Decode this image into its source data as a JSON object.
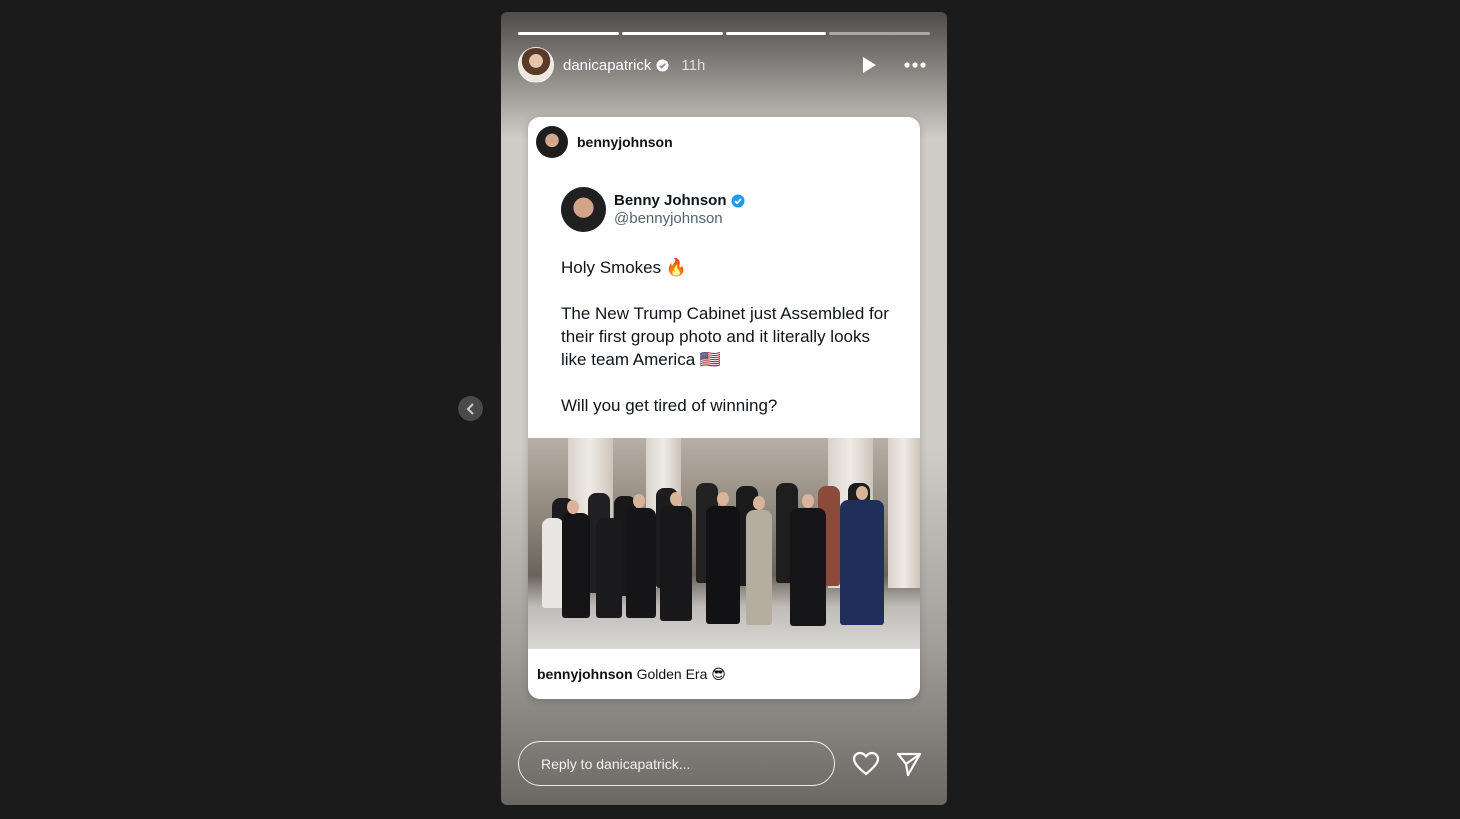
{
  "story": {
    "username": "danicapatrick",
    "time": "11h",
    "segments": 4,
    "active_segment": 3
  },
  "card": {
    "username": "bennyjohnson",
    "tweet": {
      "name": "Benny Johnson",
      "handle": "@bennyjohnson",
      "line1": "Holy Smokes 🔥",
      "line2": "The New Trump Cabinet just Assembled for their first group photo and it literally looks like team America 🇺🇸",
      "line3": "Will you get tired of winning?"
    },
    "caption_user": "bennyjohnson",
    "caption_text": "Golden Era 😎"
  },
  "reply": {
    "placeholder": "Reply to danicapatrick..."
  },
  "icons": {
    "verified": "verified-badge-icon",
    "play": "play-icon",
    "more": "more-icon",
    "heart": "heart-icon",
    "send": "send-icon",
    "prev": "chevron-left-icon"
  },
  "colors": {
    "twitter_blue": "#1d9bf0",
    "page_bg": "#1b1b1b"
  }
}
